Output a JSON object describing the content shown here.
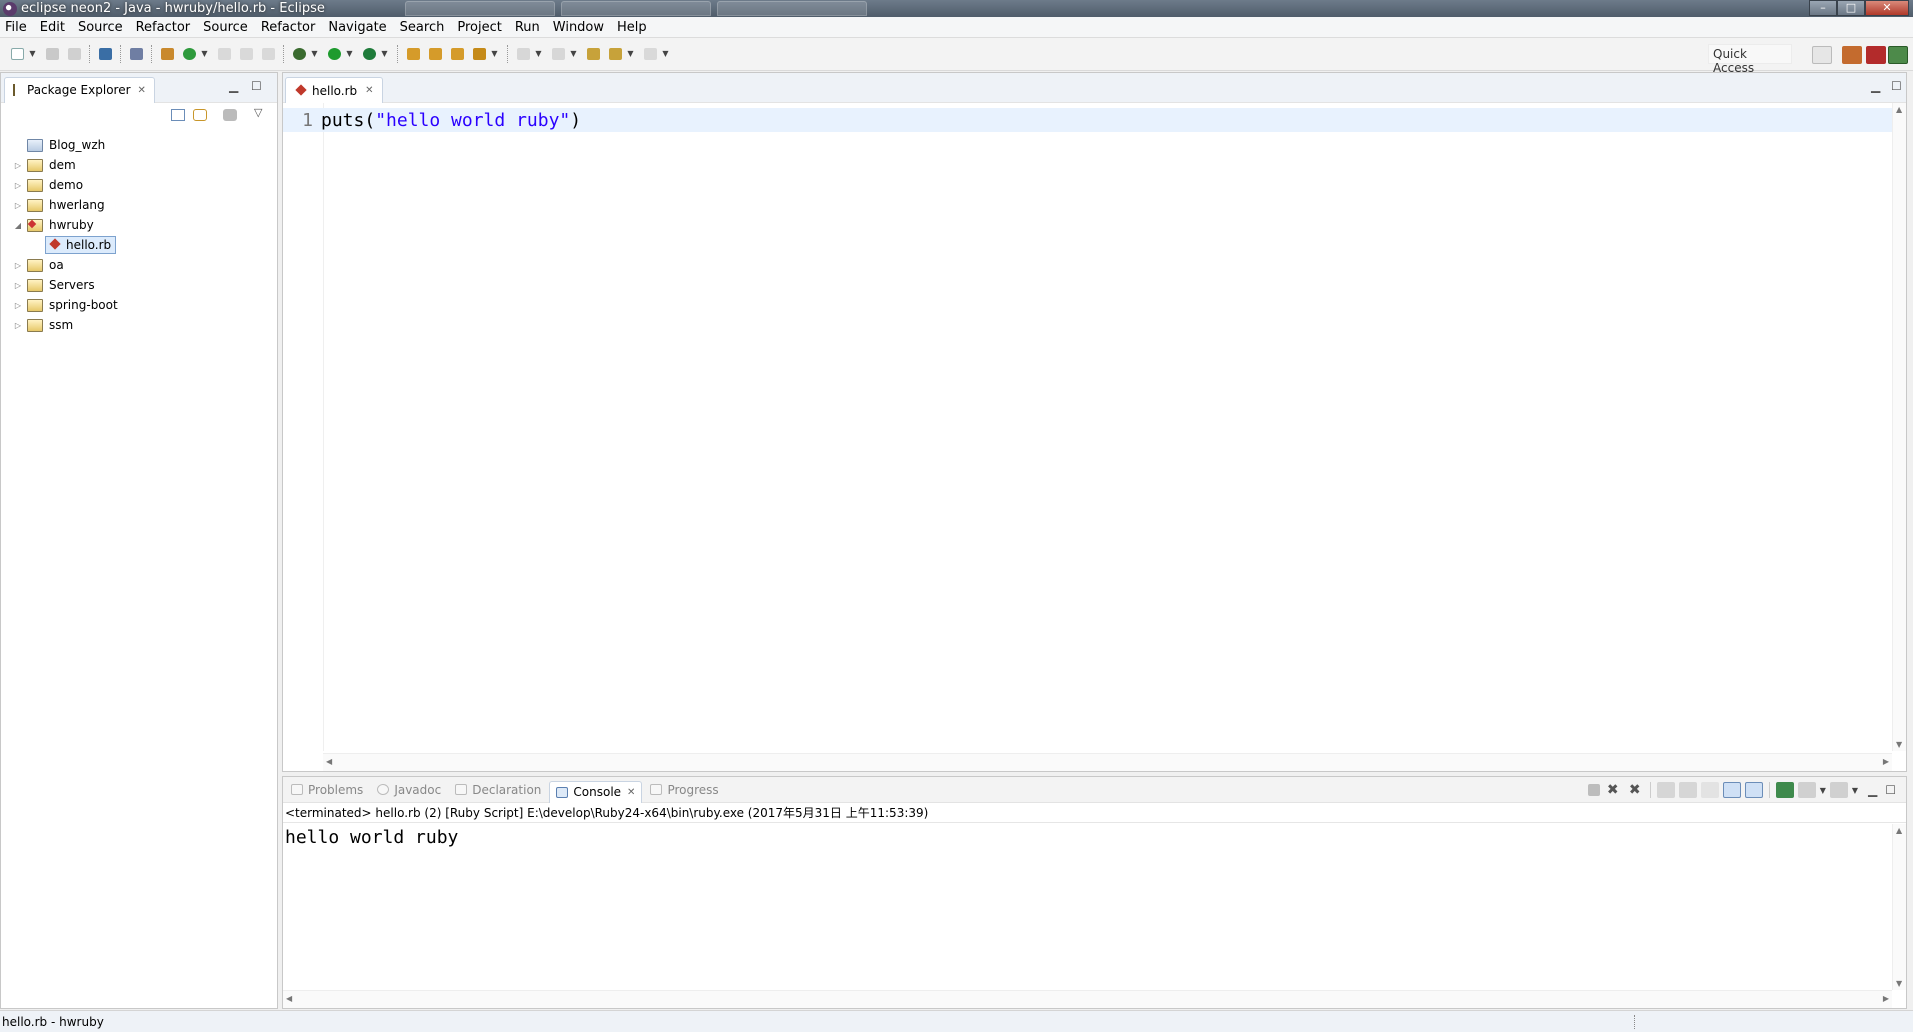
{
  "window": {
    "title": "eclipse neon2 - Java - hwruby/hello.rb - Eclipse"
  },
  "menu": [
    "File",
    "Edit",
    "Source",
    "Refactor",
    "Source",
    "Refactor",
    "Navigate",
    "Search",
    "Project",
    "Run",
    "Window",
    "Help"
  ],
  "toolbar": {
    "quick_access_label": "Quick Access"
  },
  "package_explorer": {
    "title": "Package Explorer",
    "items": [
      {
        "label": "Blog_wzh",
        "expanded": null
      },
      {
        "label": "dem",
        "expanded": false
      },
      {
        "label": "demo",
        "expanded": false
      },
      {
        "label": "hwerlang",
        "expanded": false
      },
      {
        "label": "hwruby",
        "expanded": true
      },
      {
        "label": "oa",
        "expanded": false
      },
      {
        "label": "Servers",
        "expanded": false
      },
      {
        "label": "spring-boot",
        "expanded": false
      },
      {
        "label": "ssm",
        "expanded": false
      }
    ],
    "child_file": "hello.rb"
  },
  "editor": {
    "tab_label": "hello.rb",
    "line_number": "1",
    "code_fn": "puts(",
    "code_str": "\"hello world ruby\"",
    "code_end": ")"
  },
  "console": {
    "tabs": [
      "Problems",
      "Javadoc",
      "Declaration",
      "Console",
      "Progress"
    ],
    "active_tab": "Console",
    "terminated_line": "<terminated> hello.rb (2) [Ruby Script] E:\\develop\\Ruby24-x64\\bin\\ruby.exe (2017年5月31日 上午11:53:39)",
    "output": "hello world ruby"
  },
  "status": {
    "text": "hello.rb - hwruby"
  },
  "colors": {
    "string": "#2a00ff",
    "current_line": "#e8f2fe",
    "selection": "#dcebfc"
  }
}
